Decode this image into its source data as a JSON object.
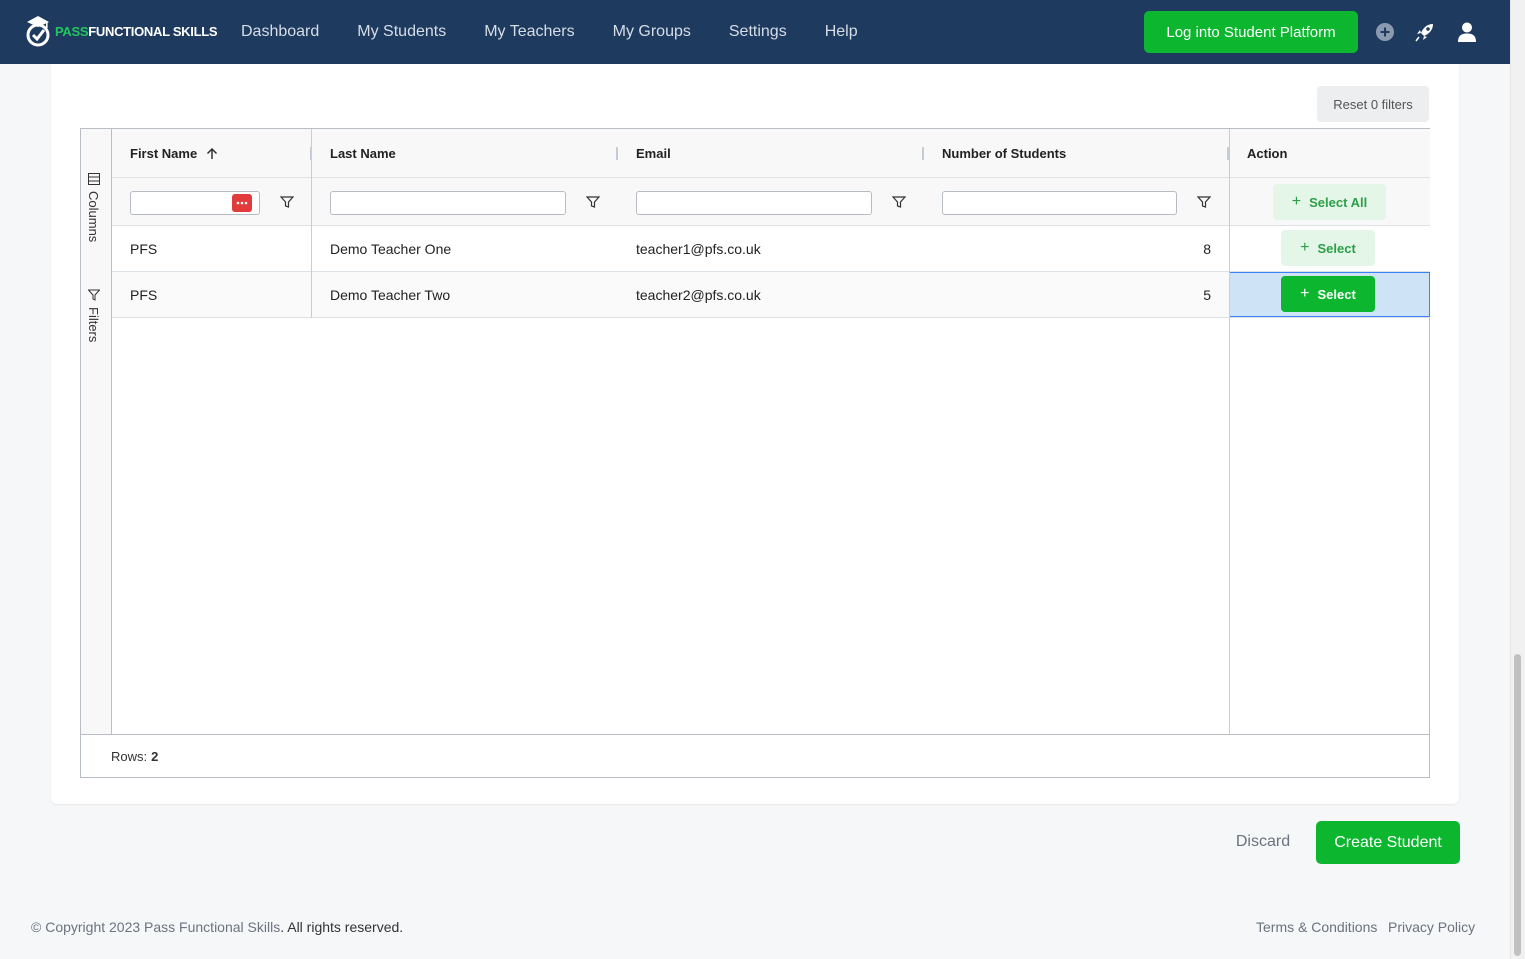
{
  "brand": {
    "accent": "PASS",
    "rest": "FUNCTIONAL SKILLS"
  },
  "nav": {
    "items": [
      "Dashboard",
      "My Students",
      "My Teachers",
      "My Groups",
      "Settings",
      "Help"
    ]
  },
  "header": {
    "login_label": "Log into Student Platform",
    "icons": [
      "plus-circle-icon",
      "rocket-icon",
      "user-icon"
    ]
  },
  "toolbar": {
    "reset_label": "Reset 0 filters"
  },
  "side_panel": {
    "columns_label": "Columns",
    "filters_label": "Filters"
  },
  "table": {
    "columns": [
      "First Name",
      "Last Name",
      "Email",
      "Number of Students",
      "Action"
    ],
    "sorted_column": "First Name",
    "sort_direction": "ascending",
    "select_all_label": "Select All",
    "select_label": "Select",
    "rows": [
      {
        "first": "PFS",
        "last": "Demo Teacher One",
        "email": "teacher1@pfs.co.uk",
        "students": "8"
      },
      {
        "first": "PFS",
        "last": "Demo Teacher Two",
        "email": "teacher2@pfs.co.uk",
        "students": "5"
      }
    ],
    "rows_label": "Rows:",
    "rows_count": "2"
  },
  "actions": {
    "discard_label": "Discard",
    "create_label": "Create Student"
  },
  "footer": {
    "copyright_prefix": "© Copyright 2023 ",
    "company_link": "Pass Functional Skills",
    "copyright_suffix": ". All rights reserved.",
    "terms": "Terms & Conditions",
    "privacy": "Privacy Policy"
  },
  "colors": {
    "nav_bg": "#1e3a5f",
    "accent_green": "#0cb62e",
    "selected_cell": "#cfe3f7"
  }
}
